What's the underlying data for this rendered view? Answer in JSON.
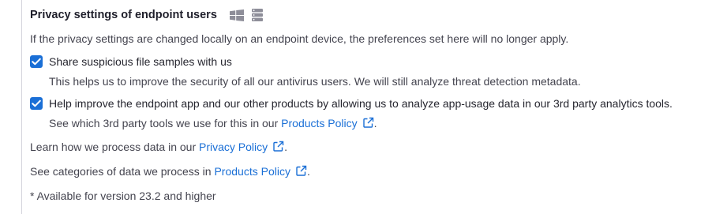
{
  "section": {
    "title": "Privacy settings of endpoint users",
    "os_icons": [
      "windows-icon",
      "server-icon"
    ],
    "intro": "If the privacy settings are changed locally on an endpoint device, the preferences set here will no longer apply."
  },
  "options": [
    {
      "checked": true,
      "label": "Share suspicious file samples with us",
      "desc": "This helps us to improve the security of all our antivirus users. We will still analyze threat detection metadata."
    },
    {
      "checked": true,
      "label": "Help improve the endpoint app and our other products by allowing us to analyze app-usage data in our 3rd party analytics tools.",
      "desc_prefix": "See which 3rd party tools we use for this in our ",
      "desc_link": "Products Policy",
      "desc_suffix": "."
    }
  ],
  "privacy_line": {
    "prefix": "Learn how we process data in our ",
    "link": "Privacy Policy",
    "suffix": "."
  },
  "categories_line": {
    "prefix": "See categories of data we process in ",
    "link": "Products Policy",
    "suffix": "."
  },
  "footnote": "* Available for version 23.2 and higher",
  "colors": {
    "accent": "#1a6fd6",
    "text": "#44444f",
    "border": "#d4d4dc"
  }
}
